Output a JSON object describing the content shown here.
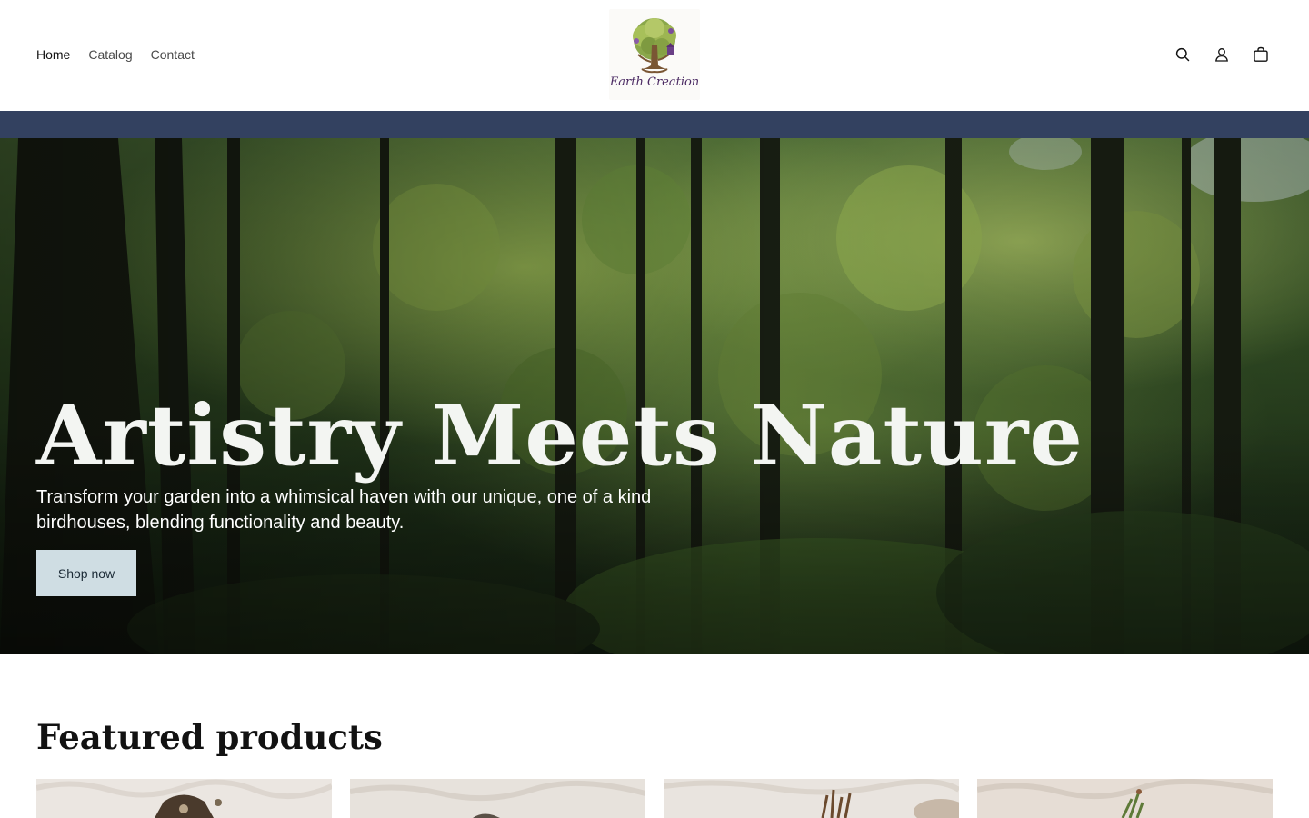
{
  "header": {
    "nav": [
      {
        "label": "Home",
        "active": true
      },
      {
        "label": "Catalog",
        "active": false
      },
      {
        "label": "Contact",
        "active": false
      }
    ],
    "logo_text": "Earth Creation",
    "icons": [
      "search-icon",
      "account-icon",
      "cart-icon"
    ]
  },
  "announcement": {
    "color": "#334160"
  },
  "hero": {
    "title": "Artistry Meets Nature",
    "text": "Transform your garden into a whimsical haven with our unique, one of a kind birdhouses, blending functionality and beauty.",
    "button_label": "Shop now"
  },
  "featured": {
    "title": "Featured products",
    "products": [
      {
        "name": "product-1"
      },
      {
        "name": "product-2"
      },
      {
        "name": "product-3"
      },
      {
        "name": "product-4"
      }
    ]
  },
  "colors": {
    "accent_button": "#cfdde3",
    "announcement_bar": "#334160",
    "text": "#121212"
  }
}
